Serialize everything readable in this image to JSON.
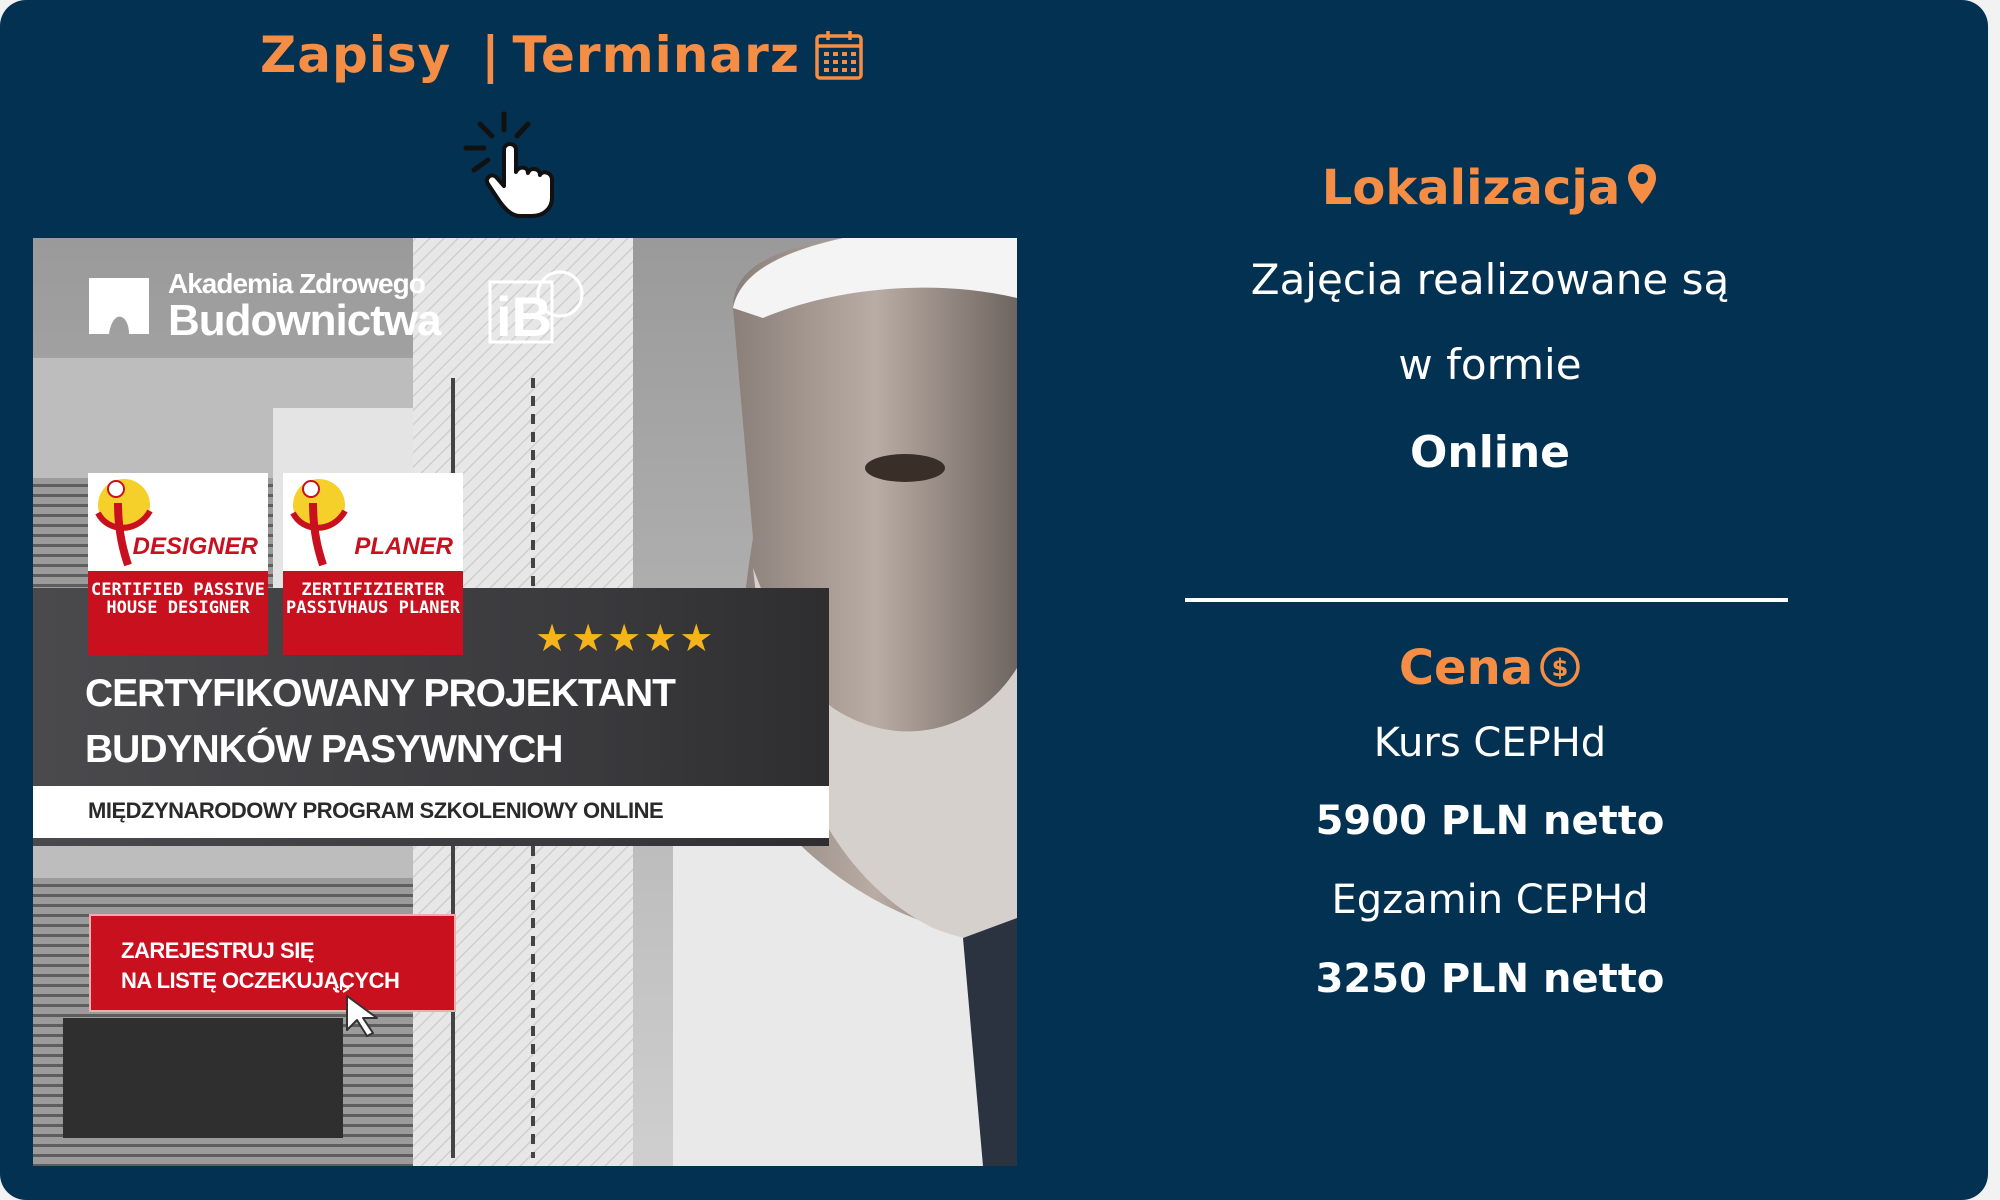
{
  "nav": {
    "signup": "Zapisy",
    "separator": "|",
    "schedule": "Terminarz"
  },
  "icons": {
    "calendar": "calendar-icon",
    "click": "hand-click-icon",
    "pin": "map-pin-icon",
    "price": "dollar-circle-icon"
  },
  "banner": {
    "logo_line1": "Akademia Zdrowego",
    "logo_line2": "Budownictwa",
    "logo2": "iBP",
    "badge1_name": "DESIGNER",
    "badge1_text": "CERTIFIED PASSIVE HOUSE DESIGNER",
    "badge2_name": "PLANER",
    "badge2_text": "ZERTIFIZIERTER PASSIVHAUS PLANER",
    "rating": 5,
    "stars": "★★★★★",
    "title_line1": "CERTYFIKOWANY PROJEKTANT",
    "title_line2": "BUDYNKÓW PASYWNYCH",
    "subtitle": "MIĘDZYNARODOWY PROGRAM  SZKOLENIOWY ONLINE",
    "cta_line1": "ZAREJESTRUJ SIĘ",
    "cta_line2": "NA LISTĘ OCZEKUJĄCYCH"
  },
  "location": {
    "title": "Lokalizacja",
    "line1": "Zajęcia realizowane są",
    "line2": "w formie",
    "line3": "Online"
  },
  "price": {
    "title": "Cena",
    "course_label": "Kurs CEPHd",
    "course_price": "5900 PLN netto",
    "exam_label": "Egzamin CEPHd",
    "exam_price": "3250 PLN netto"
  },
  "colors": {
    "background": "#033152",
    "accent": "#f58d45",
    "red": "#c8101f",
    "star": "#f6b31b"
  }
}
